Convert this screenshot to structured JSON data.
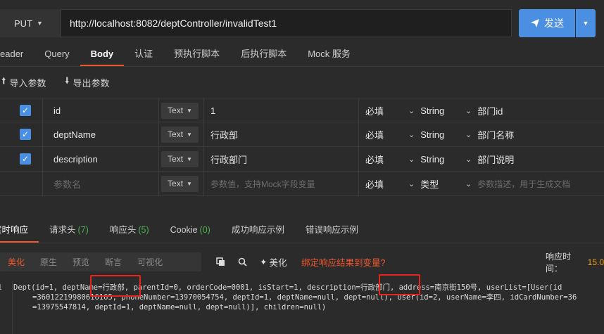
{
  "request": {
    "method": "PUT",
    "url": "http://localhost:8082/deptController/invalidTest1",
    "send_label": "发送"
  },
  "req_tabs": [
    "eader",
    "Query",
    "Body",
    "认证",
    "预执行脚本",
    "后执行脚本",
    "Mock 服务"
  ],
  "req_active_tab": "Body",
  "import_label": "导入参数",
  "export_label": "导出参数",
  "params": [
    {
      "checked": true,
      "name": "id",
      "type": "Text",
      "value": "1",
      "required": "必填",
      "datatype": "String",
      "desc": "部门id"
    },
    {
      "checked": true,
      "name": "deptName",
      "type": "Text",
      "value": "行政部",
      "required": "必填",
      "datatype": "String",
      "desc": "部门名称"
    },
    {
      "checked": true,
      "name": "description",
      "type": "Text",
      "value": "行政部门",
      "required": "必填",
      "datatype": "String",
      "desc": "部门说明"
    }
  ],
  "empty_row": {
    "name_placeholder": "参数名",
    "type": "Text",
    "value_placeholder": "参数值，支持Mock字段变量",
    "required": "必填",
    "datatype": "类型",
    "desc_placeholder": "参数描述，用于生成文档"
  },
  "resp_tabs": [
    {
      "label": "实时响应",
      "count": ""
    },
    {
      "label": "请求头",
      "count": "(7)"
    },
    {
      "label": "响应头",
      "count": "(5)"
    },
    {
      "label": "Cookie",
      "count": "(0)"
    },
    {
      "label": "成功响应示例",
      "count": ""
    },
    {
      "label": "错误响应示例",
      "count": ""
    }
  ],
  "view_modes": [
    "美化",
    "原生",
    "预览",
    "断言",
    "可视化"
  ],
  "active_view": "美化",
  "beautify_label": "美化",
  "bind_link": "绑定响应结果到变量?",
  "resp_time_label": "响应时间：",
  "resp_time_value": "15.0",
  "code": {
    "line_no": "1",
    "line1": "Dept(id=1, deptName=行政部, parentId=0, orderCode=0001, isStart=1, description=行政部门, address=南京街150号, userList=[User(id",
    "line2": "=36012219980616165, phoneNumber=13970054754, deptId=1, deptName=null, dept=null), User(id=2, userName=李四, idCardNumber=36",
    "line3": "=13975547814, deptId=1, deptName=null, dept=null)], children=null)"
  },
  "colors": {
    "accent": "#f0562e",
    "primary": "#4a8fe2",
    "highlight_box": "#e6251c"
  }
}
